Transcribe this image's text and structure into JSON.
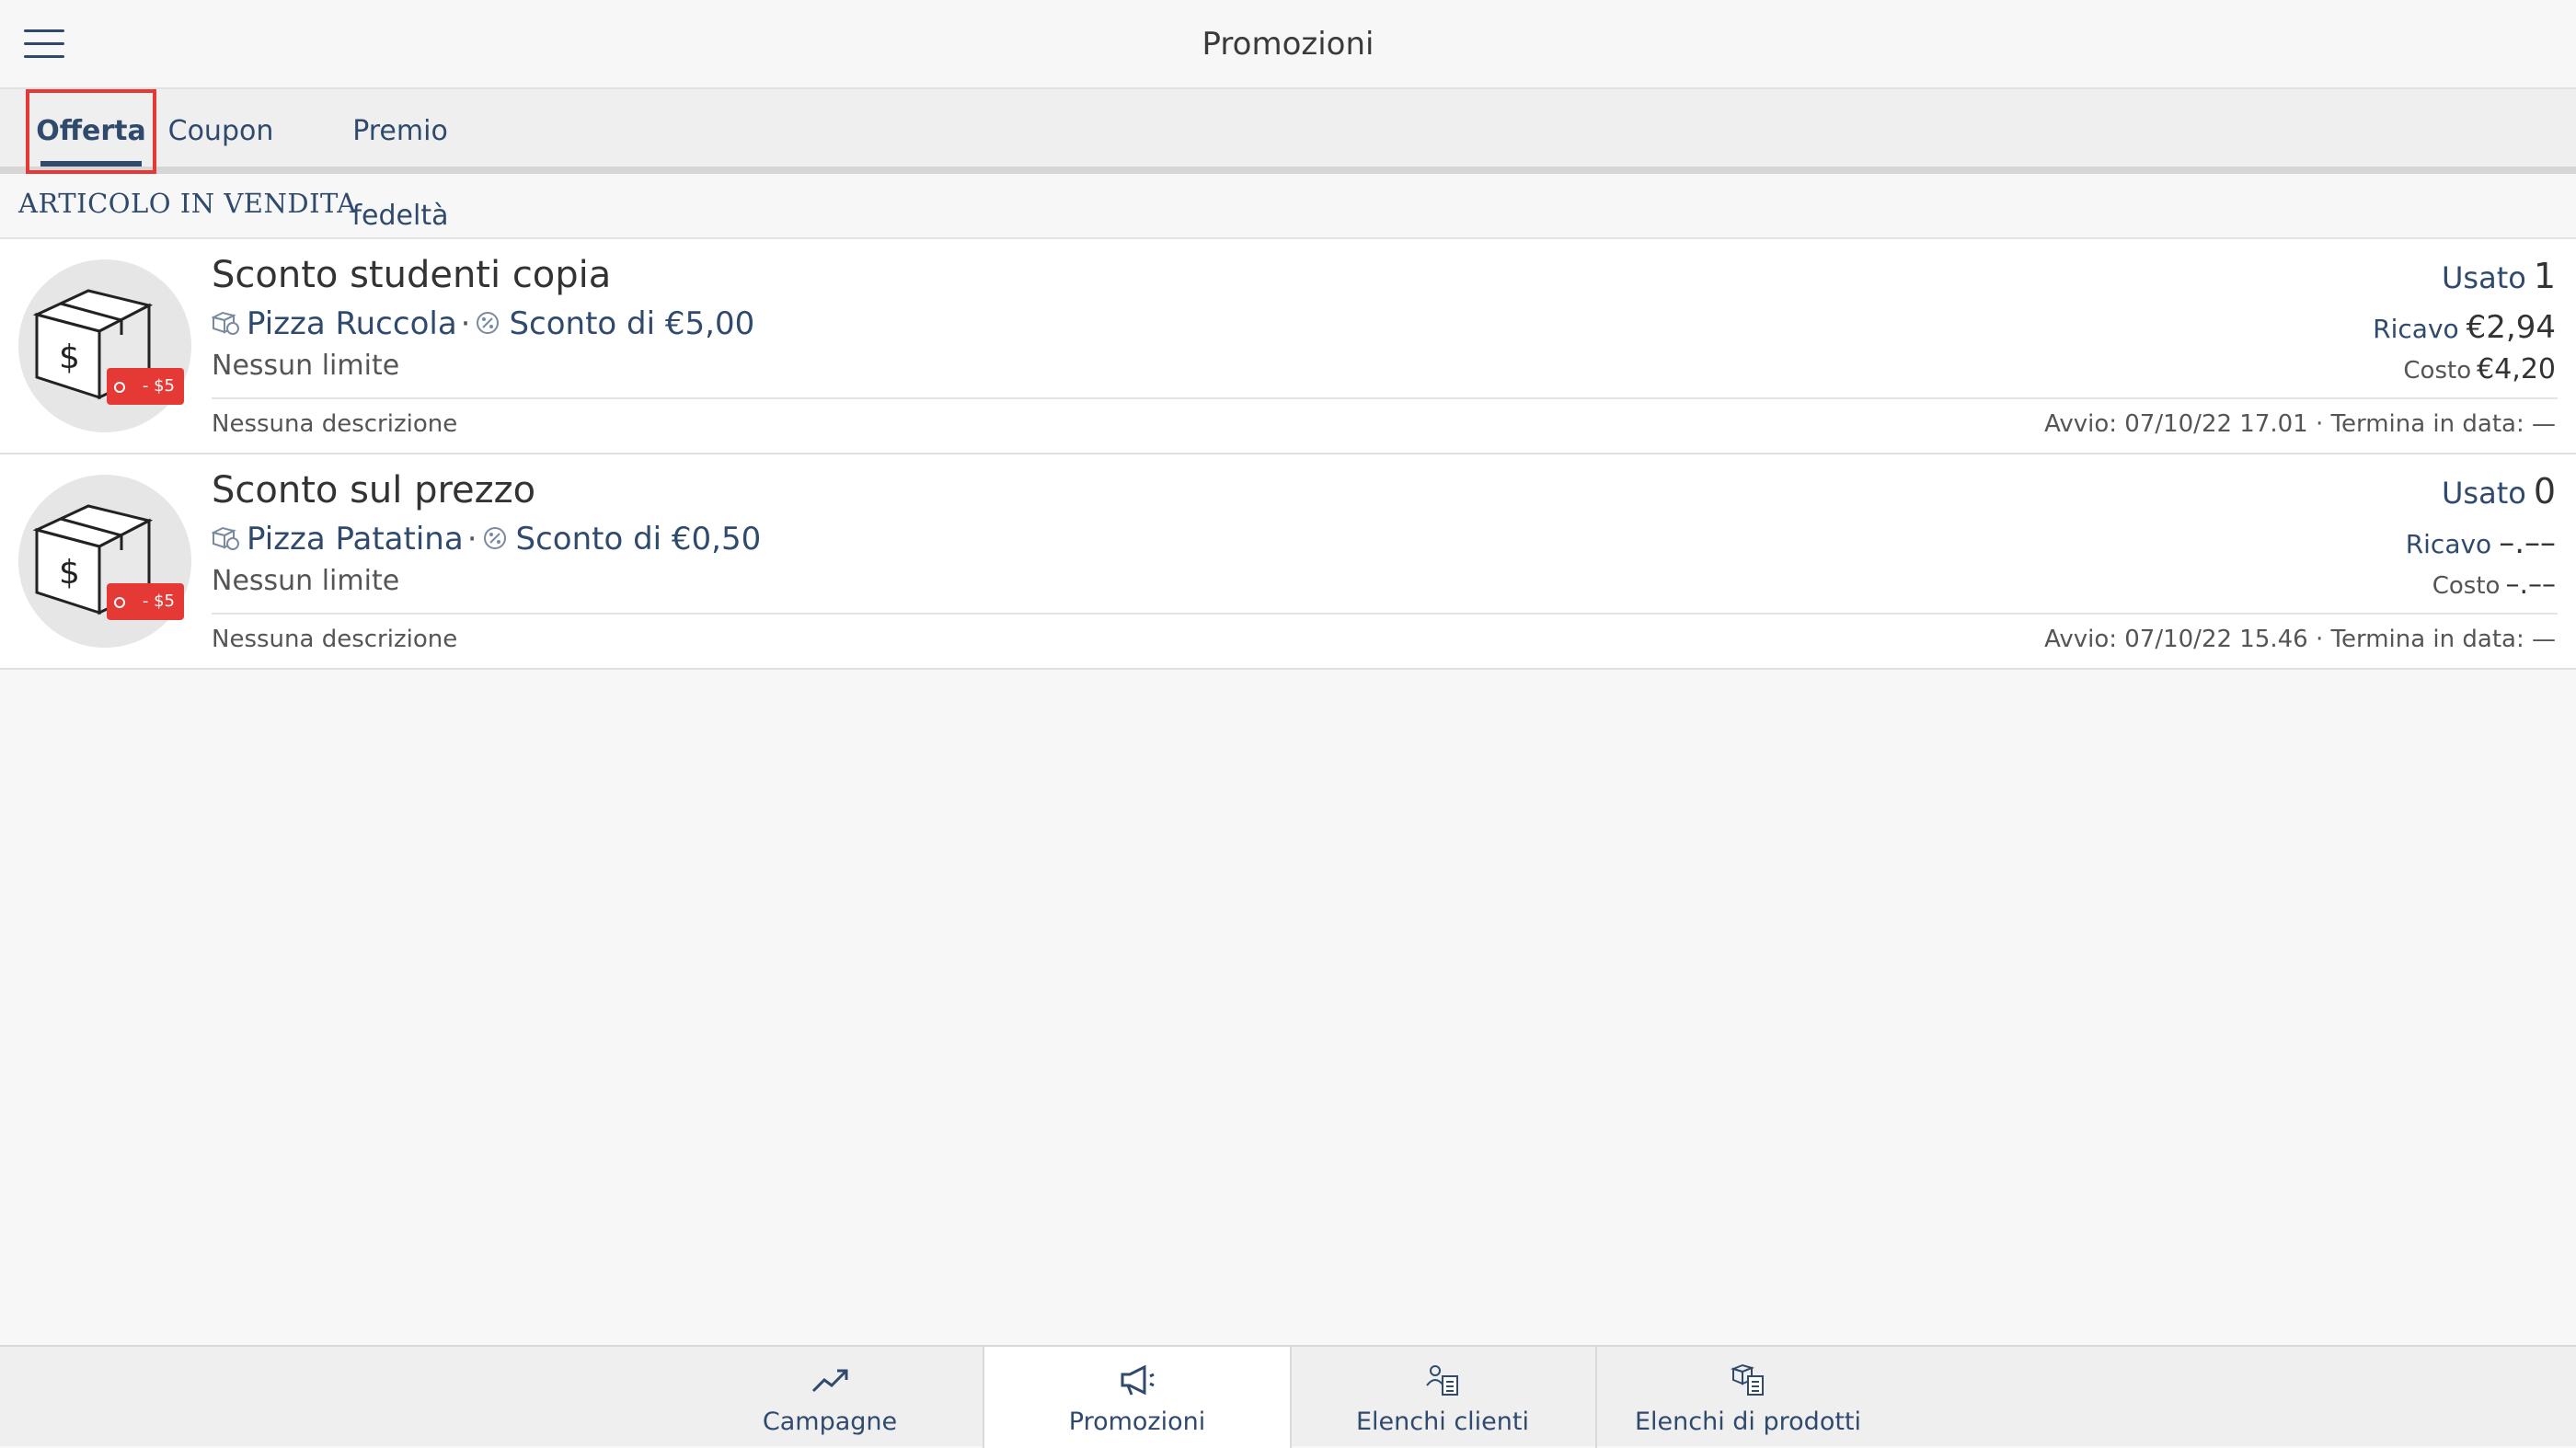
{
  "header": {
    "title": "Promozioni",
    "menu_icon": "hamburger-menu-icon"
  },
  "tabs": [
    {
      "label": "Offerta",
      "active": true
    },
    {
      "label": "Coupon",
      "active": false
    },
    {
      "label": "Premio fedeltà",
      "active": false
    }
  ],
  "section": {
    "title": "ARTICOLO IN VENDITA"
  },
  "items": [
    {
      "title": "Sconto studenti copia",
      "product": "Pizza Ruccola",
      "discount": "Sconto di €5,00",
      "limit": "Nessun limite",
      "description": "Nessuna descrizione",
      "tag": "- $5",
      "used_label": "Usato",
      "used_value": "1",
      "revenue_label": "Ricavo",
      "revenue_value": "€2,94",
      "cost_label": "Costo",
      "cost_value": "€4,20",
      "dates": "Avvio: 07/10/22 17.01 · Termina in data: —"
    },
    {
      "title": "Sconto sul prezzo",
      "product": "Pizza Patatina",
      "discount": "Sconto di €0,50",
      "limit": "Nessun limite",
      "description": "Nessuna descrizione",
      "tag": "- $5",
      "used_label": "Usato",
      "used_value": "0",
      "revenue_label": "Ricavo",
      "revenue_value": "–.––",
      "cost_label": "Costo",
      "cost_value": "–.––",
      "dates": "Avvio: 07/10/22 15.46 · Termina in data: —"
    }
  ],
  "bottom_nav": [
    {
      "label": "Campagne",
      "icon": "trending-up-icon",
      "active": false
    },
    {
      "label": "Promozioni",
      "icon": "megaphone-icon",
      "active": true
    },
    {
      "label": "Elenchi clienti",
      "icon": "customer-list-icon",
      "active": false
    },
    {
      "label": "Elenchi di prodotti",
      "icon": "product-list-icon",
      "active": false
    }
  ],
  "colors": {
    "accent": "#2f4a6d",
    "highlight": "#e53935",
    "tag": "#e53935"
  }
}
